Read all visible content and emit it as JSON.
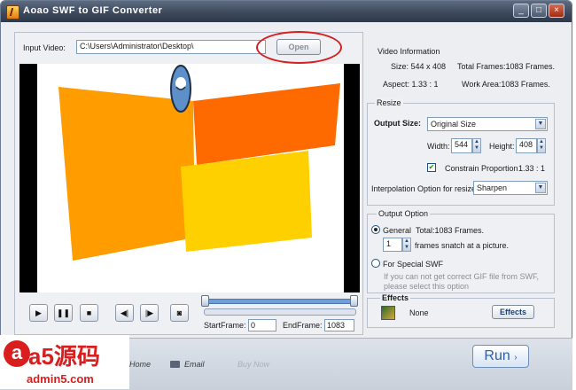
{
  "window": {
    "title": "Aoao SWF to GIF Converter",
    "minimize": "_",
    "maximize": "□",
    "close": "×"
  },
  "input": {
    "label": "Input Video:",
    "path": "C:\\Users\\Administrator\\Desktop\\",
    "open_label": "Open"
  },
  "video_info": {
    "title": "Video Information",
    "size": "Size: 544 x 408",
    "total_frames": "Total Frames:1083 Frames.",
    "aspect": "Aspect: 1.33 : 1",
    "work_area": "Work Area:1083 Frames."
  },
  "resize": {
    "title": "Resize",
    "output_size_label": "Output Size:",
    "output_size_value": "Original Size",
    "width_label": "Width:",
    "width_value": "544",
    "height_label": "Height:",
    "height_value": "408",
    "constrain_label": "Constrain Proportion",
    "constrain_ratio": "1.33 : 1",
    "interp_label": "Interpolation Option for resize:",
    "interp_value": "Sharpen"
  },
  "output_option": {
    "title": "Output Option",
    "general_label": "General",
    "total_frames": "Total:1083 Frames.",
    "frames_value": "1",
    "frames_label": "frames snatch at a picture.",
    "special_label": "For Special SWF",
    "special_note_1": "If you can not get correct GIF file from SWF,",
    "special_note_2": "please select this option"
  },
  "effects": {
    "title": "Effects",
    "value": "None",
    "button": "Effects"
  },
  "frames": {
    "start_label": "StartFrame:",
    "start_value": "0",
    "end_label": "EndFrame:",
    "end_value": "1083"
  },
  "bottom": {
    "home": "Home",
    "email": "Email",
    "buy_now": "Buy Now",
    "run": "Run"
  },
  "watermark": {
    "brand": "a5源码",
    "url": "admin5.com"
  },
  "colors": {
    "accent": "#2d5fa8",
    "orange": "#ff9c00",
    "red_orange": "#ff6a00",
    "yellow": "#ffd000",
    "highlight": "#d42020"
  }
}
